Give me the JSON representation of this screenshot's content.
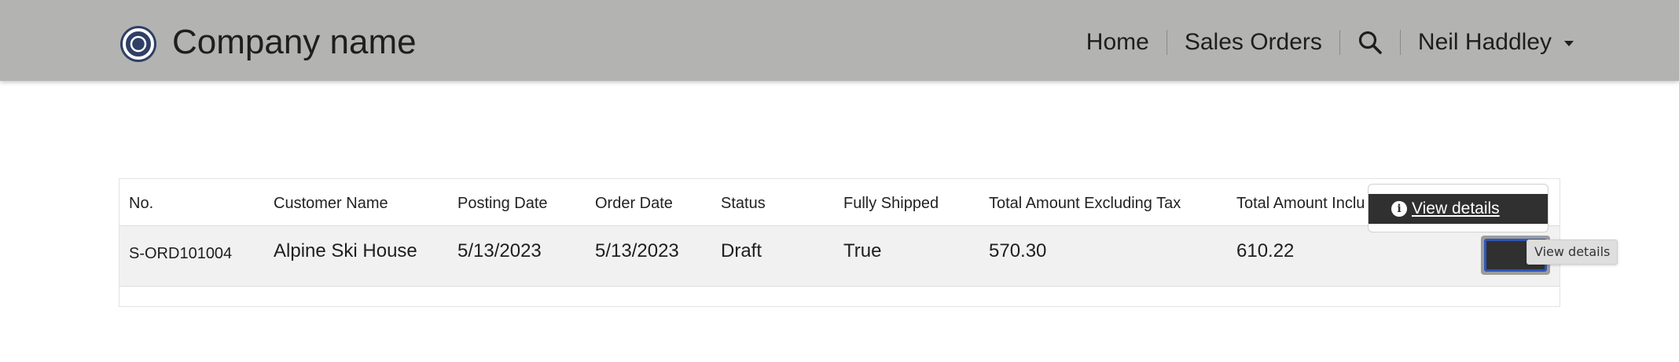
{
  "header": {
    "brand": "Company name",
    "nav": {
      "home": "Home",
      "sales_orders": "Sales Orders",
      "search_icon": "search-icon",
      "user": "Neil Haddley"
    },
    "colors": {
      "background": "#b3b3b1",
      "logo": "#2f3f66"
    }
  },
  "table": {
    "columns": [
      "No.",
      "Customer Name",
      "Posting Date",
      "Order Date",
      "Status",
      "Fully Shipped",
      "Total Amount Excluding Tax",
      "Total Amount Inclu"
    ],
    "rows": [
      {
        "no": "S-ORD101004",
        "customer_name": "Alpine Ski House",
        "posting_date": "5/13/2023",
        "order_date": "5/13/2023",
        "status": "Draft",
        "fully_shipped": "True",
        "total_excl_tax": "570.30",
        "total_incl_tax": "610.22"
      }
    ]
  },
  "row_menu": {
    "item_label": "View details",
    "item_icon": "info-icon"
  },
  "tooltip": {
    "text": "View details"
  }
}
